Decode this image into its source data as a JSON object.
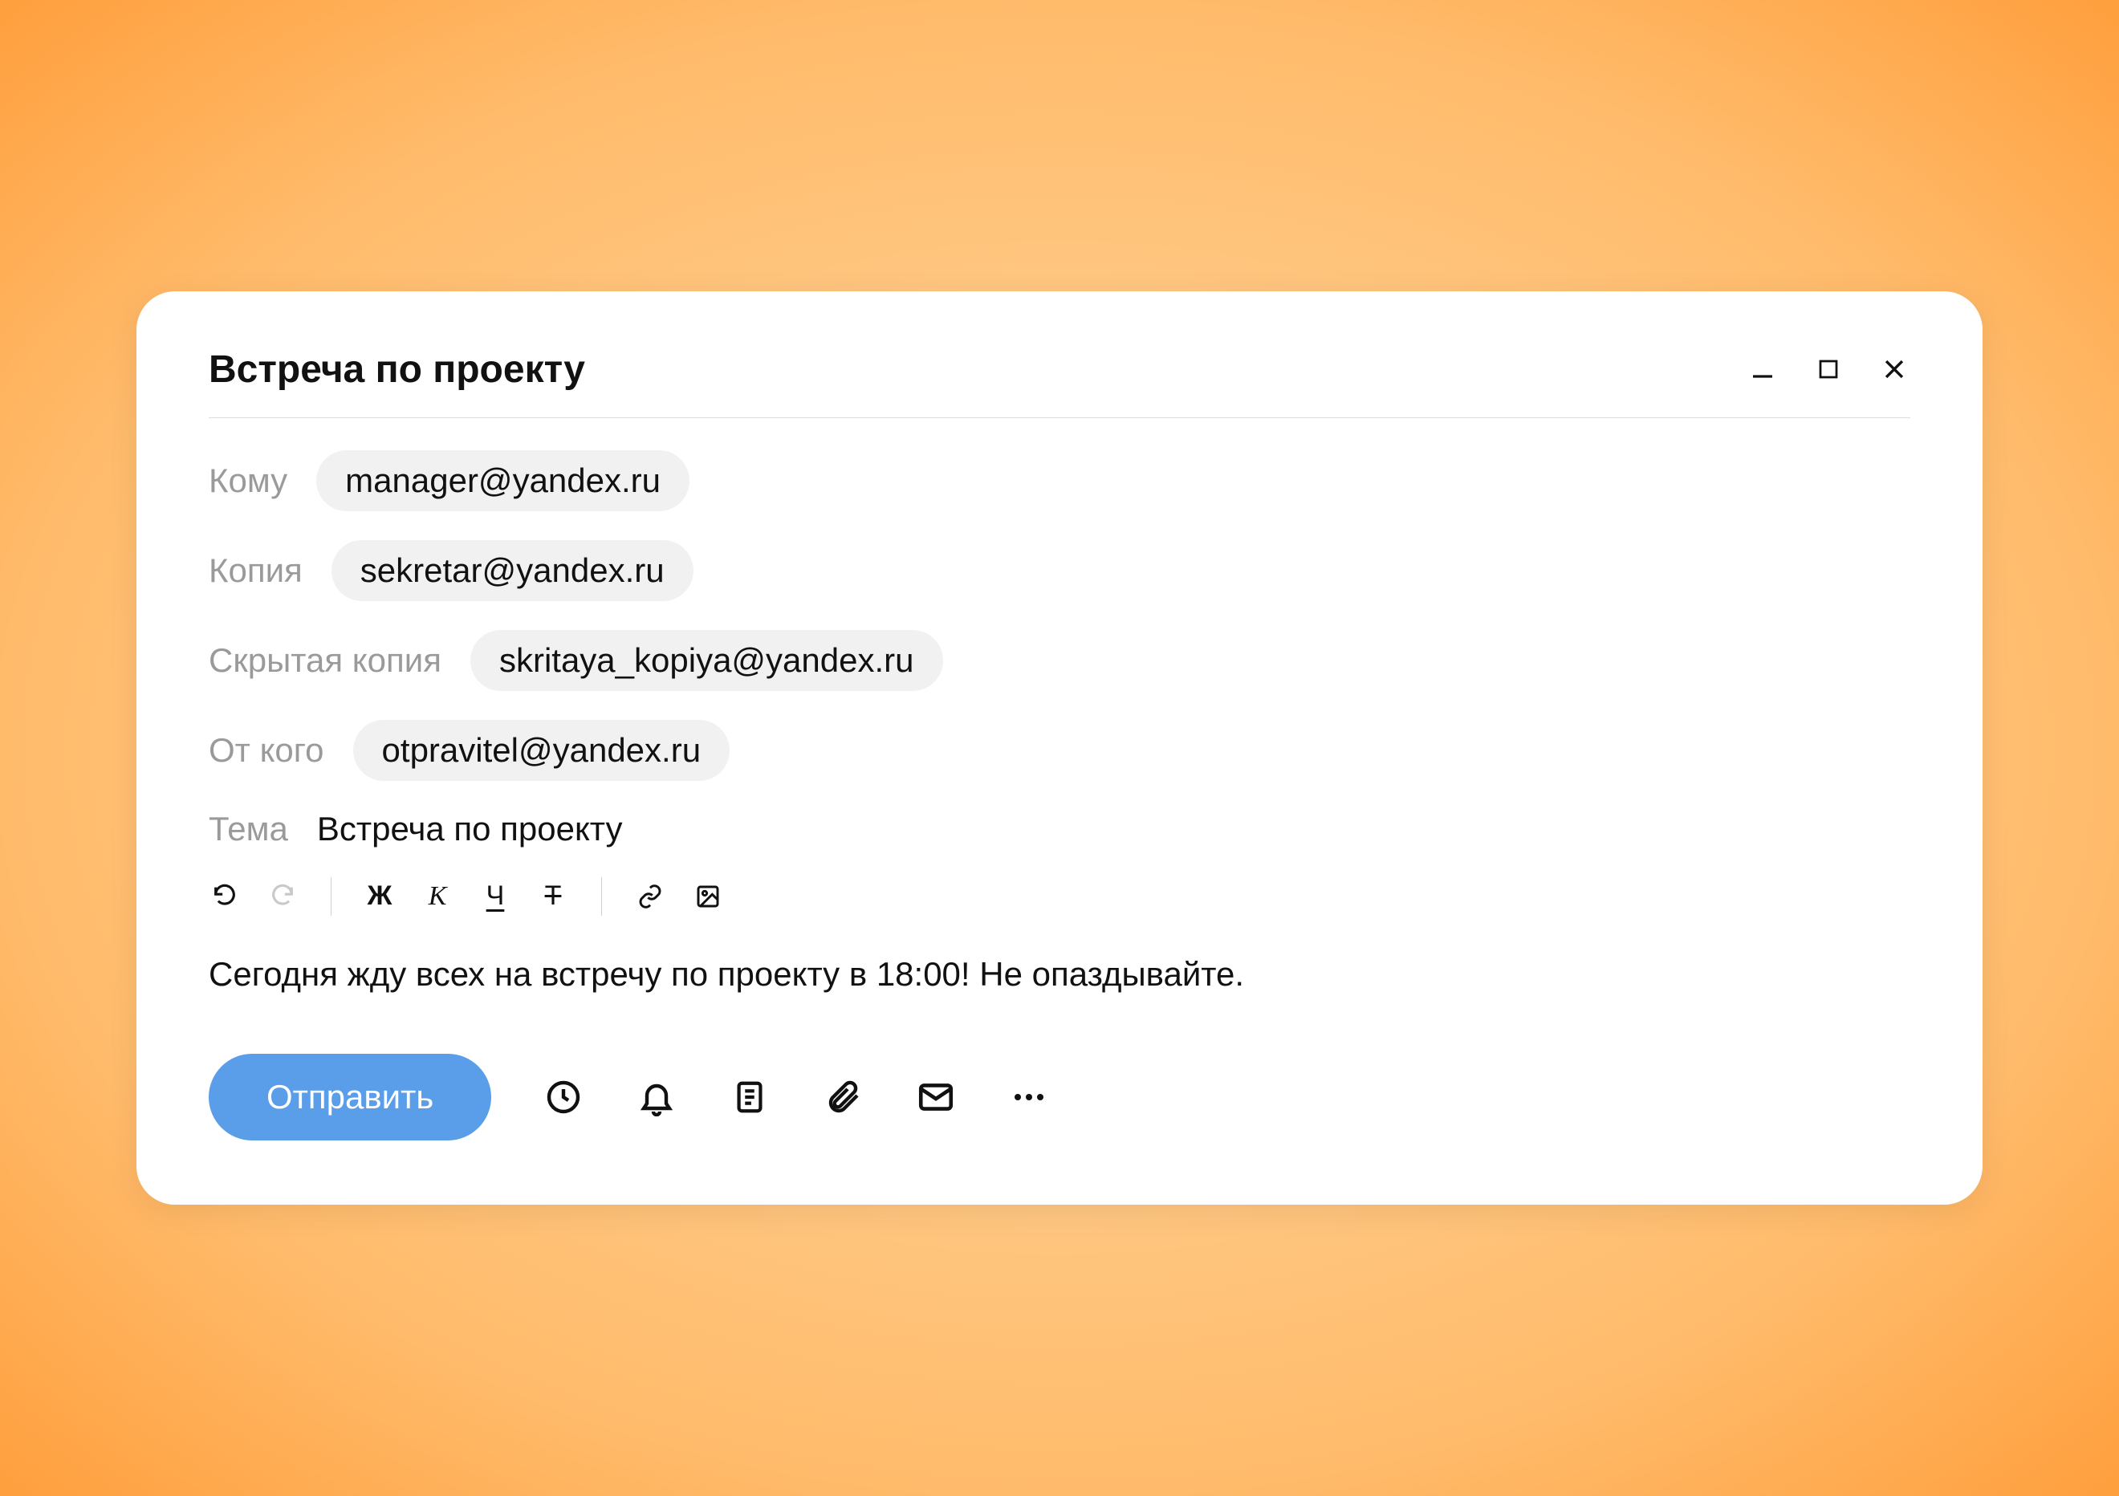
{
  "window": {
    "title": "Встреча по проекту"
  },
  "fields": {
    "to_label": "Кому",
    "to_value": "manager@yandex.ru",
    "cc_label": "Копия",
    "cc_value": "sekretar@yandex.ru",
    "bcc_label": "Скрытая копия",
    "bcc_value": "skritaya_kopiya@yandex.ru",
    "from_label": "От кого",
    "from_value": "otpravitel@yandex.ru",
    "subject_label": "Тема",
    "subject_value": "Встреча по проекту"
  },
  "toolbar": {
    "bold_glyph": "Ж",
    "italic_glyph": "К",
    "underline_glyph": "Ч",
    "strike_glyph": "Т"
  },
  "body": "Сегодня жду всех на встречу по проекту в 18:00! Не  опаздывайте.",
  "footer": {
    "send_label": "Отправить"
  },
  "colors": {
    "accent": "#5a9eea",
    "chip_bg": "#f1f1f1",
    "label_muted": "#9a9a9a"
  }
}
